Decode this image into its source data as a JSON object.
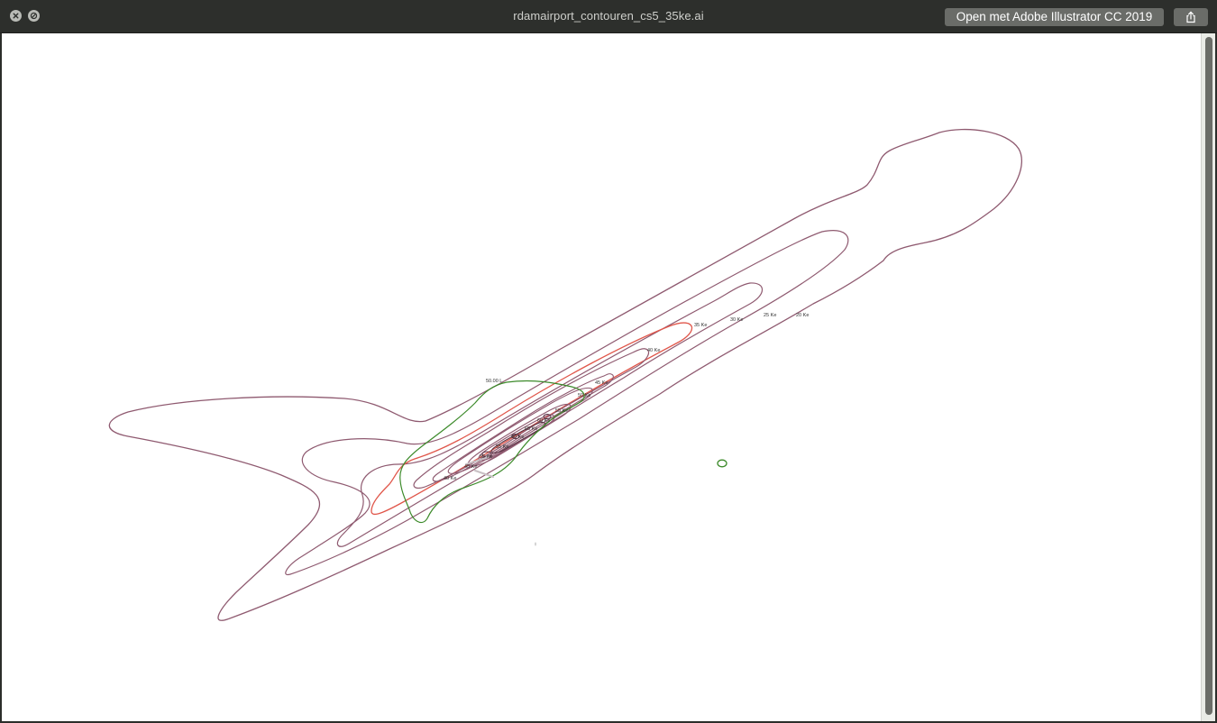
{
  "window": {
    "title": "rdamairport_contouren_cs5_35ke.ai",
    "open_button_label": "Open met Adobe Illustrator CC 2019"
  },
  "icons": {
    "close": "close-icon",
    "fullscreen": "fullscreen-icon",
    "share": "share-icon"
  },
  "colors": {
    "contour_ke": "#8f5a70",
    "contour_35ke": "#e0564a",
    "contour_green": "#3c8a2a"
  },
  "contour_labels": {
    "ke35": "35 Ke",
    "ke30": "30 Ke",
    "ke25": "25 Ke",
    "ke20": "20 Ke",
    "ke40": "40 Ke",
    "ke45": "45 Ke",
    "ke50": "50 Ke",
    "ke55": "55 Ke",
    "ke60": "60 Ke",
    "ke65": "65 Ke",
    "green_label": "50.00 L"
  }
}
